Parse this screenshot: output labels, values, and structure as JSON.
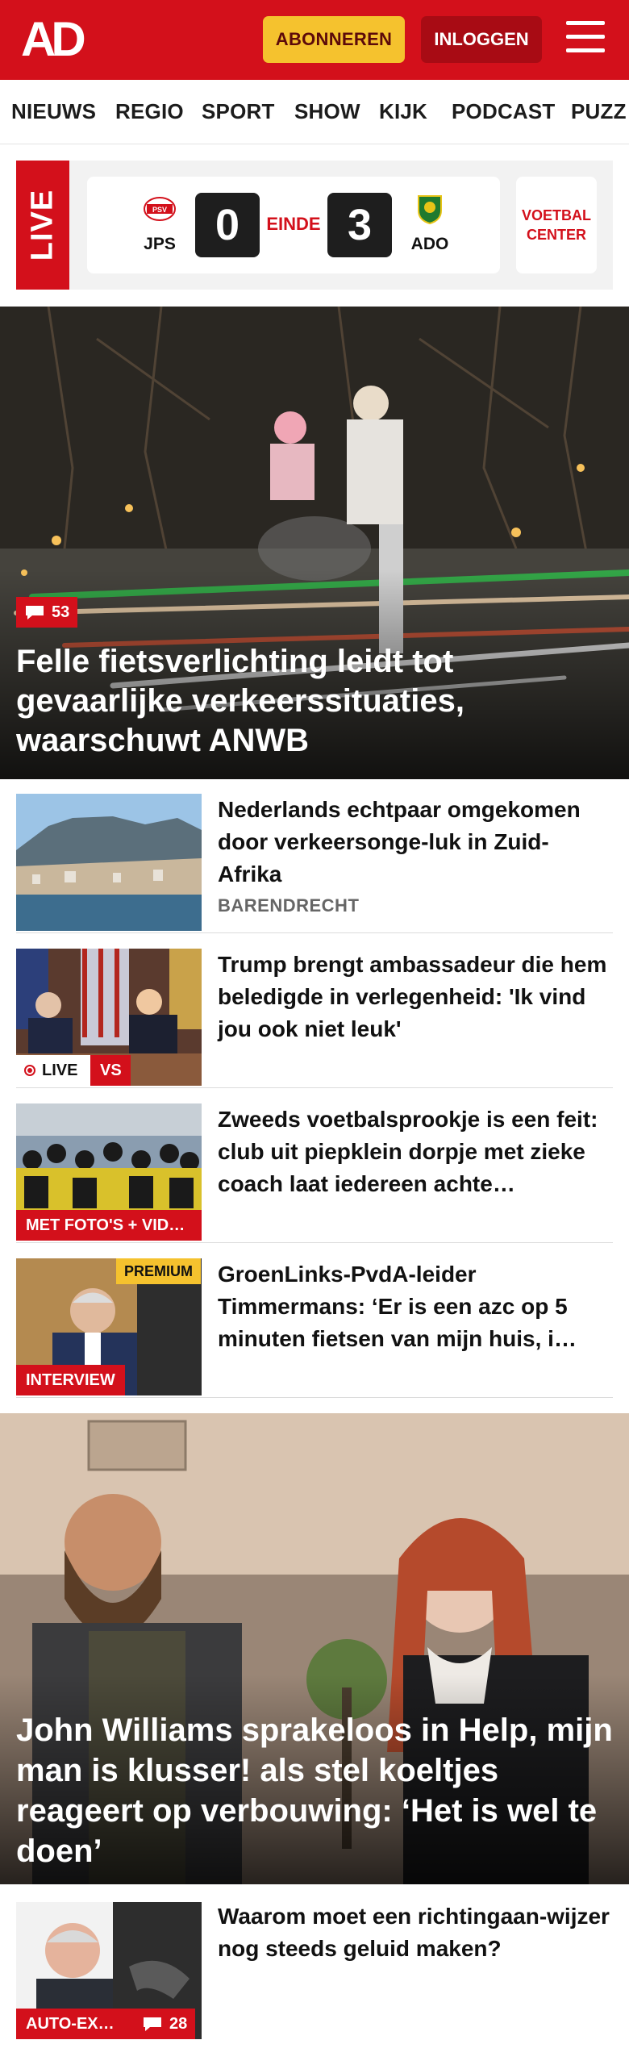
{
  "header": {
    "logo_text": "AD",
    "subscribe_label": "ABONNEREN",
    "login_label": "INLOGGEN",
    "menu_icon": "hamburger-icon",
    "brand_color": "#d3101b"
  },
  "nav": {
    "items": [
      "NIEUWS",
      "REGIO",
      "SPORT",
      "SHOW",
      "KIJK",
      "PODCAST",
      "PUZZ"
    ]
  },
  "live": {
    "tag": "LIVE",
    "home_team": "JPS",
    "home_score": "0",
    "status": "EINDE",
    "away_score": "3",
    "away_team": "ADO",
    "center_button": "VOETBAL CENTER"
  },
  "hero": {
    "comments": "53",
    "title": "Felle fietsverlichting leidt tot gevaarlijke verkeerssituaties, waarschuwt ANWB"
  },
  "articles": [
    {
      "title": "Nederlands echtpaar omgekomen door verkeersonge-luk in Zuid-Afrika",
      "subtitle": "BARENDRECHT"
    },
    {
      "title": "Trump brengt ambassadeur die hem beledigde in verlegenheid: 'Ik vind jou ook niet leuk'",
      "tag_live": "LIVE",
      "tag_vs": "VS"
    },
    {
      "title": "Zweeds voetbalsprookje is een feit: club uit piepklein dorpje met zieke coach laat iedereen achte…",
      "tag": "MET FOTO'S + VID…"
    },
    {
      "title": "GroenLinks-PvdA-leider Timmermans: ‘Er is een azc op 5 minuten fietsen van mijn huis, i…",
      "tag": "INTERVIEW",
      "premium": "PREMIUM"
    }
  ],
  "feature": {
    "title": "John Williams sprakeloos in Help, mijn man is klusser! als stel koeltjes reageert op verbouwing: ‘Het is wel te doen’"
  },
  "bottom_article": {
    "title": "Waarom moet een richtingaan-wijzer nog steeds geluid maken?",
    "tag": "AUTO-EX…",
    "comments": "28"
  }
}
